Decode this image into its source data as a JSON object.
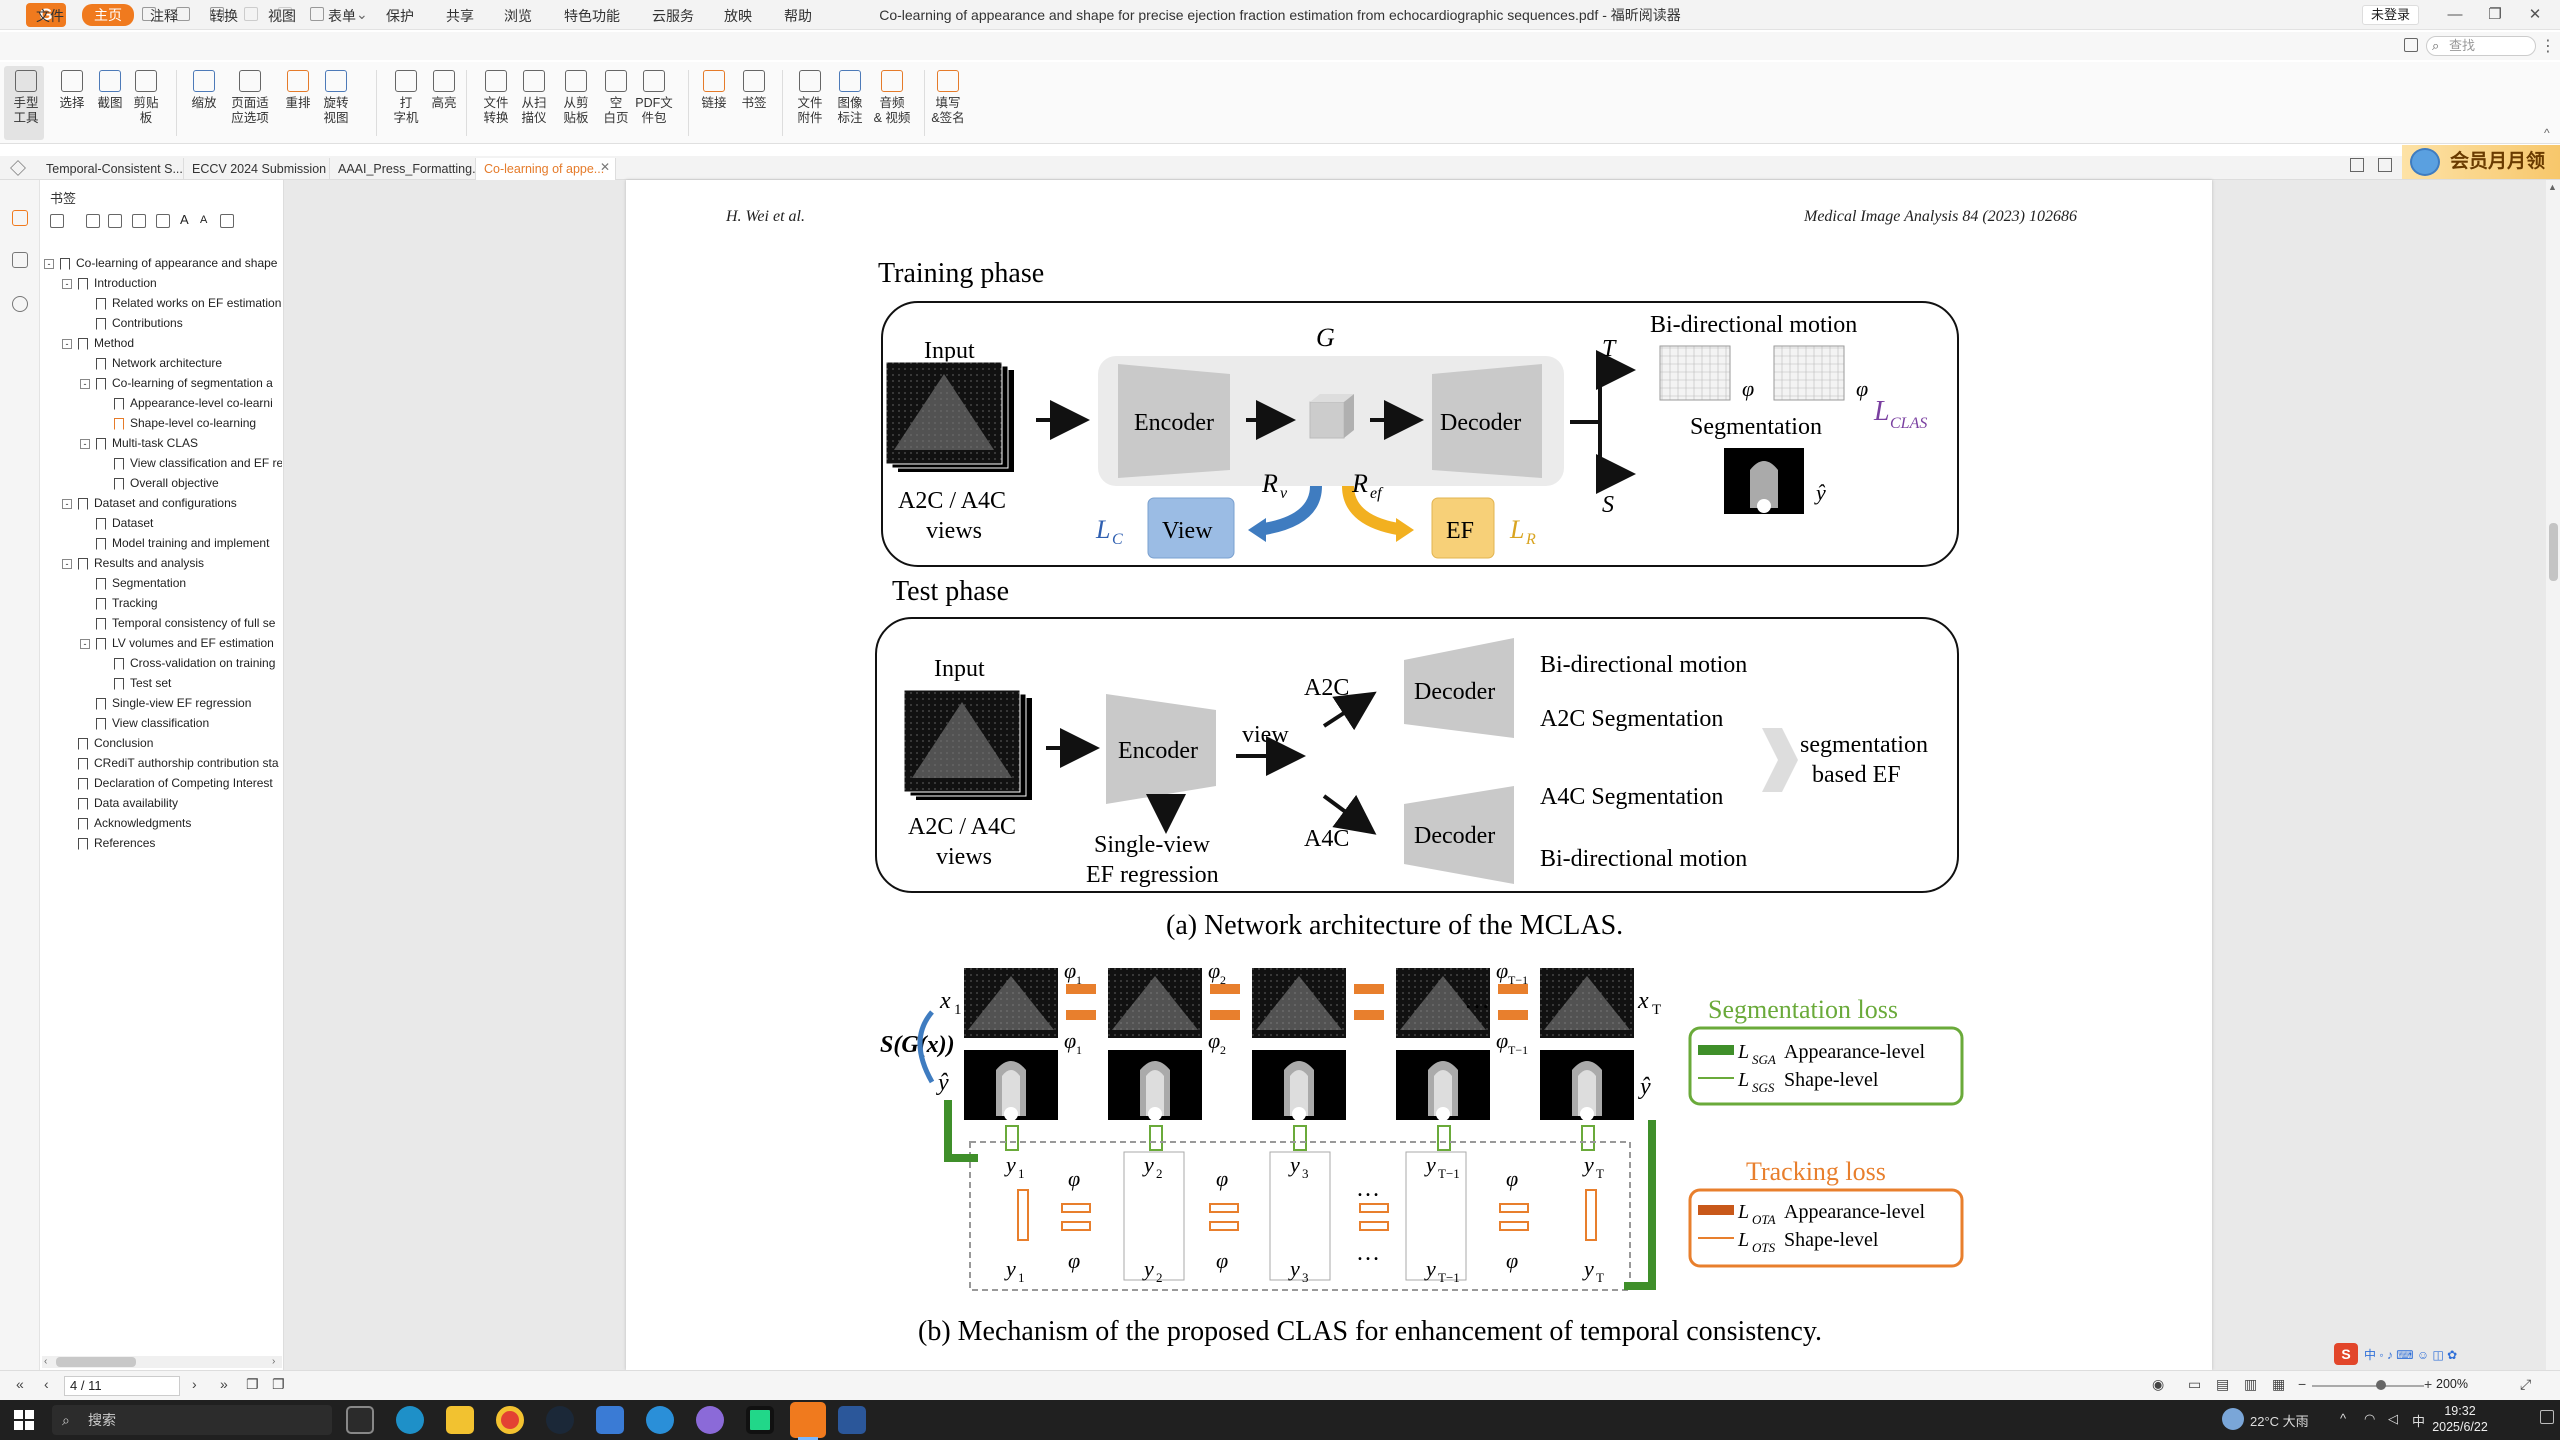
{
  "window": {
    "title": "Co-learning of appearance and shape for precise ejection fraction estimation from echocardiographic sequences.pdf - 福昕阅读器",
    "login": "未登录",
    "logo": "G"
  },
  "menu": [
    "文件",
    "主页",
    "注释",
    "转换",
    "视图",
    "表单",
    "保护",
    "共享",
    "浏览",
    "特色功能",
    "云服务",
    "放映",
    "帮助"
  ],
  "search_placeholder": "查找",
  "ribbon": [
    {
      "line1": "手型",
      "line2": "工具"
    },
    {
      "line1": "选择",
      "line2": ""
    },
    {
      "line1": "截图",
      "line2": ""
    },
    {
      "line1": "剪贴",
      "line2": "板"
    },
    {
      "line1": "缩放",
      "line2": ""
    },
    {
      "line1": "页面适",
      "line2": "应选项"
    },
    {
      "line1": "重排",
      "line2": ""
    },
    {
      "line1": "旋转",
      "line2": "视图"
    },
    {
      "line1": "打",
      "line2": "字机"
    },
    {
      "line1": "高亮",
      "line2": ""
    },
    {
      "line1": "文件",
      "line2": "转换"
    },
    {
      "line1": "从扫",
      "line2": "描仪"
    },
    {
      "line1": "从剪",
      "line2": "贴板"
    },
    {
      "line1": "空",
      "line2": "白页"
    },
    {
      "line1": "PDF文",
      "line2": "件包"
    },
    {
      "line1": "链接",
      "line2": ""
    },
    {
      "line1": "书签",
      "line2": ""
    },
    {
      "line1": "文件",
      "line2": "附件"
    },
    {
      "line1": "图像",
      "line2": "标注"
    },
    {
      "line1": "音频",
      "line2": "& 视频"
    },
    {
      "line1": "填写",
      "line2": "&签名"
    }
  ],
  "tabs": [
    "Temporal-Consistent S...",
    "ECCV 2024 Submission ...",
    "AAAI_Press_Formatting...",
    "Co-learning of appe..."
  ],
  "vip_label": "会员月月领",
  "bookmarks_title": "书签",
  "bookmarks": [
    {
      "level": 0,
      "label": "Co-learning of appearance and shape",
      "expander": "-"
    },
    {
      "level": 1,
      "label": "Introduction",
      "expander": "-"
    },
    {
      "level": 2,
      "label": "Related works on EF estimation",
      "expander": ""
    },
    {
      "level": 2,
      "label": "Contributions",
      "expander": ""
    },
    {
      "level": 1,
      "label": "Method",
      "expander": "-"
    },
    {
      "level": 2,
      "label": "Network architecture",
      "expander": ""
    },
    {
      "level": 2,
      "label": "Co-learning of segmentation a",
      "expander": "-"
    },
    {
      "level": 3,
      "label": "Appearance-level co-learni",
      "expander": ""
    },
    {
      "level": 3,
      "label": "Shape-level co-learning",
      "expander": "",
      "active": true
    },
    {
      "level": 2,
      "label": "Multi-task CLAS",
      "expander": "-"
    },
    {
      "level": 3,
      "label": "View classification and EF re",
      "expander": ""
    },
    {
      "level": 3,
      "label": "Overall objective",
      "expander": ""
    },
    {
      "level": 1,
      "label": "Dataset and configurations",
      "expander": "-"
    },
    {
      "level": 2,
      "label": "Dataset",
      "expander": ""
    },
    {
      "level": 2,
      "label": "Model training and implement",
      "expander": ""
    },
    {
      "level": 1,
      "label": "Results and analysis",
      "expander": "-"
    },
    {
      "level": 2,
      "label": "Segmentation",
      "expander": ""
    },
    {
      "level": 2,
      "label": "Tracking",
      "expander": ""
    },
    {
      "level": 2,
      "label": "Temporal consistency of full se",
      "expander": ""
    },
    {
      "level": 2,
      "label": "LV volumes and EF estimation",
      "expander": "-"
    },
    {
      "level": 3,
      "label": "Cross-validation on training",
      "expander": ""
    },
    {
      "level": 3,
      "label": "Test set",
      "expander": ""
    },
    {
      "level": 2,
      "label": "Single-view EF regression",
      "expander": ""
    },
    {
      "level": 2,
      "label": "View classification",
      "expander": ""
    },
    {
      "level": 1,
      "label": "Conclusion",
      "expander": ""
    },
    {
      "level": 1,
      "label": "CRediT authorship contribution sta",
      "expander": ""
    },
    {
      "level": 1,
      "label": "Declaration of Competing Interest",
      "expander": ""
    },
    {
      "level": 1,
      "label": "Data availability",
      "expander": ""
    },
    {
      "level": 1,
      "label": "Acknowledgments",
      "expander": ""
    },
    {
      "level": 1,
      "label": "References",
      "expander": ""
    }
  ],
  "paper": {
    "header_left": "H. Wei et al.",
    "header_right": "Medical Image Analysis 84 (2023) 102686",
    "training_phase": "Training phase",
    "test_phase": "Test phase",
    "input": "Input",
    "views_line1": "A2C / A4C",
    "views_line2": "views",
    "encoder": "Encoder",
    "decoder": "Decoder",
    "G": "G",
    "T": "T",
    "S": "S",
    "bidirectional_motion": "Bi-directional motion",
    "segmentation": "Segmentation",
    "view": "View",
    "ef": "EF",
    "R_v": "R",
    "R_v_sub": "v",
    "R_ef": "R",
    "R_ef_sub": "ef",
    "L_C": "L",
    "L_C_sub": "C",
    "L_R": "L",
    "L_R_sub": "R",
    "L_CLAS": "L",
    "L_CLAS_sub": "CLAS",
    "phi": "φ",
    "y_hat": "ŷ",
    "test_view": "view",
    "a2c": "A2C",
    "a4c": "A4C",
    "single_view_line1": "Single-view",
    "single_view_line2": "EF regression",
    "a2c_seg": "A2C Segmentation",
    "a4c_seg": "A4C Segmentation",
    "seg_ef_line1": "segmentation",
    "seg_ef_line2": "based EF",
    "caption_a": "(a) Network architecture of the MCLAS.",
    "caption_b": "(b) Mechanism of the proposed CLAS for enhancement of temporal consistency.",
    "seg_loss_title": "Segmentation loss",
    "seg_loss_app": "Appearance-level",
    "seg_loss_shape": "Shape-level",
    "seg_loss_app_sub": "SGA",
    "seg_loss_shape_sub": "SGS",
    "track_loss_title": "Tracking loss",
    "track_loss_app": "Appearance-level",
    "track_loss_shape": "Shape-level",
    "track_loss_app_sub": "OTA",
    "track_loss_shape_sub": "OTS",
    "sgx": "S(G(x))",
    "x1": "x",
    "xT": "x",
    "sub_1": "1",
    "sub_T": "T",
    "dots": "…",
    "frames_sub": [
      "1",
      "2",
      "3",
      "T−1",
      "T"
    ],
    "phi_subs": [
      "1",
      "2",
      "T−1"
    ]
  },
  "status": {
    "page_indicator": "4 / 11",
    "zoom": "200%"
  },
  "taskbar": {
    "search": "搜索",
    "weather": "22°C 大雨",
    "ime": "中",
    "time": "19:32",
    "date": "2025/6/22"
  },
  "colors": {
    "accent": "#f07a1e",
    "seg_green": "#6aaa3a",
    "track_orange": "#e87f2d",
    "view_blue": "#9bbce4",
    "ef_yellow": "#f7d078",
    "purple": "#7a3fa0"
  }
}
